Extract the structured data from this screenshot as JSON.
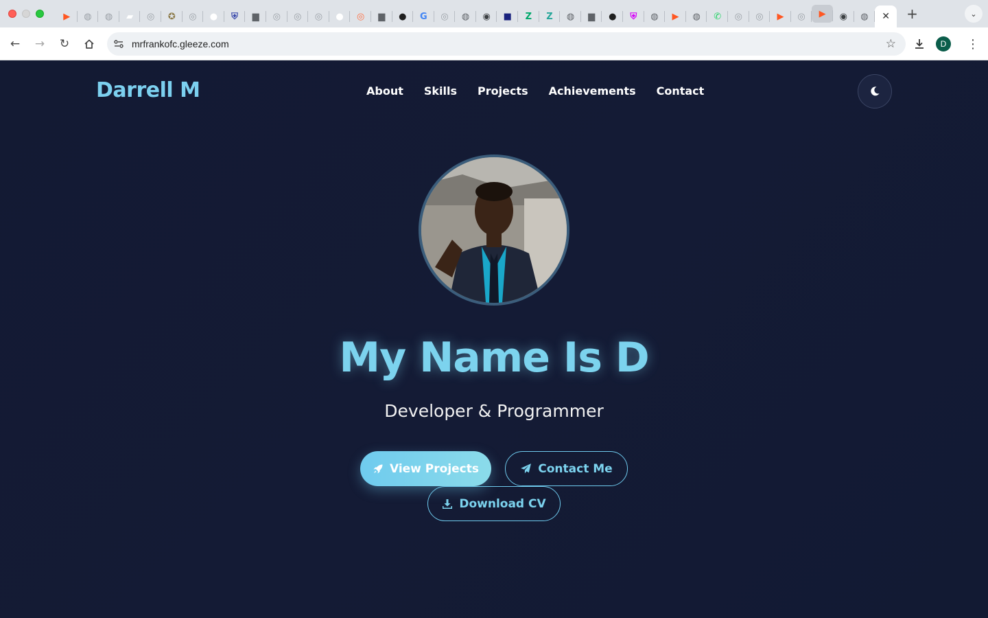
{
  "browser": {
    "tab_count": 40,
    "tabs": [
      {
        "icon": "orange-arrow-icon",
        "color": "#ff5722",
        "glyph": "▶"
      },
      {
        "icon": "globe-icon",
        "color": "#9aa0a6",
        "glyph": "◍"
      },
      {
        "icon": "globe-icon",
        "color": "#9aa0a6",
        "glyph": "◍"
      },
      {
        "icon": "puzzle-icon",
        "color": "#ffffff",
        "glyph": "▰"
      },
      {
        "icon": "loading-icon",
        "color": "#9aa0a6",
        "glyph": "◎"
      },
      {
        "icon": "crest-icon",
        "color": "#8d7b4a",
        "glyph": "✪"
      },
      {
        "icon": "loading-icon",
        "color": "#9aa0a6",
        "glyph": "◎"
      },
      {
        "icon": "github-icon",
        "color": "#ffffff",
        "glyph": "●"
      },
      {
        "icon": "shield-icon",
        "color": "#3949ab",
        "glyph": "⛨"
      },
      {
        "icon": "folder-icon",
        "color": "#5f6368",
        "glyph": "▆"
      },
      {
        "icon": "loading-icon",
        "color": "#9aa0a6",
        "glyph": "◎"
      },
      {
        "icon": "loading-icon",
        "color": "#9aa0a6",
        "glyph": "◎"
      },
      {
        "icon": "loading-icon",
        "color": "#9aa0a6",
        "glyph": "◎"
      },
      {
        "icon": "github-icon",
        "color": "#ffffff",
        "glyph": "●"
      },
      {
        "icon": "orange-loading-icon",
        "color": "#ff7043",
        "glyph": "◎"
      },
      {
        "icon": "folder-icon",
        "color": "#5f6368",
        "glyph": "▆"
      },
      {
        "icon": "github-icon",
        "color": "#1f1f1f",
        "glyph": "●"
      },
      {
        "icon": "google-icon",
        "color": "#4285f4",
        "glyph": "G"
      },
      {
        "icon": "loading-icon",
        "color": "#9aa0a6",
        "glyph": "◎"
      },
      {
        "icon": "globe-icon",
        "color": "#5f6368",
        "glyph": "◍"
      },
      {
        "icon": "chrome-icon",
        "color": "#3c4043",
        "glyph": "◉"
      },
      {
        "icon": "profile-icon",
        "color": "#1a237e",
        "glyph": "■"
      },
      {
        "icon": "z-icon",
        "color": "#00a86b",
        "glyph": "Z"
      },
      {
        "icon": "z-circle-icon",
        "color": "#26a69a",
        "glyph": "Z"
      },
      {
        "icon": "globe-icon",
        "color": "#5f6368",
        "glyph": "◍"
      },
      {
        "icon": "folder-icon",
        "color": "#5f6368",
        "glyph": "▆"
      },
      {
        "icon": "github-icon",
        "color": "#1f1f1f",
        "glyph": "●"
      },
      {
        "icon": "brave-shield-icon",
        "color": "#d500f9",
        "glyph": "⛨"
      },
      {
        "icon": "globe-icon",
        "color": "#5f6368",
        "glyph": "◍"
      },
      {
        "icon": "orange-arrow-icon",
        "color": "#ff5722",
        "glyph": "▶"
      },
      {
        "icon": "globe-icon",
        "color": "#5f6368",
        "glyph": "◍"
      },
      {
        "icon": "whatsapp-icon",
        "color": "#25d366",
        "glyph": "✆"
      },
      {
        "icon": "loading-icon",
        "color": "#9aa0a6",
        "glyph": "◎"
      },
      {
        "icon": "loading-icon",
        "color": "#9aa0a6",
        "glyph": "◎"
      },
      {
        "icon": "orange-arrow-icon",
        "color": "#ff5722",
        "glyph": "▶"
      },
      {
        "icon": "loading-icon",
        "color": "#9aa0a6",
        "glyph": "◎"
      },
      {
        "icon": "orange-arrow-icon",
        "color": "#ff5722",
        "glyph": "▶"
      },
      {
        "icon": "chrome-icon",
        "color": "#3c4043",
        "glyph": "◉"
      },
      {
        "icon": "globe-icon",
        "color": "#5f6368",
        "glyph": "◍"
      }
    ],
    "highlighted_tab_index": 36,
    "active_tab_close": "✕",
    "new_tab": "+",
    "tab_search": "⌄",
    "address": {
      "url": "mrfrankofc.gleeze.com"
    },
    "profile_initial": "D",
    "colors": {
      "profile": "#0b5d4a"
    }
  },
  "site": {
    "logo": "Darrell M",
    "nav": [
      "About",
      "Skills",
      "Projects",
      "Achievements",
      "Contact"
    ],
    "theme_toggle_icon": "moon-icon",
    "hero": {
      "title": "My Name Is D",
      "subtitle": "Developer & Programmer",
      "buttons": {
        "view_projects": "View Projects",
        "contact_me": "Contact Me",
        "download_cv": "Download CV"
      }
    },
    "colors": {
      "background": "#131a33",
      "accent": "#7cd3ee",
      "text": "#ffffff"
    }
  }
}
